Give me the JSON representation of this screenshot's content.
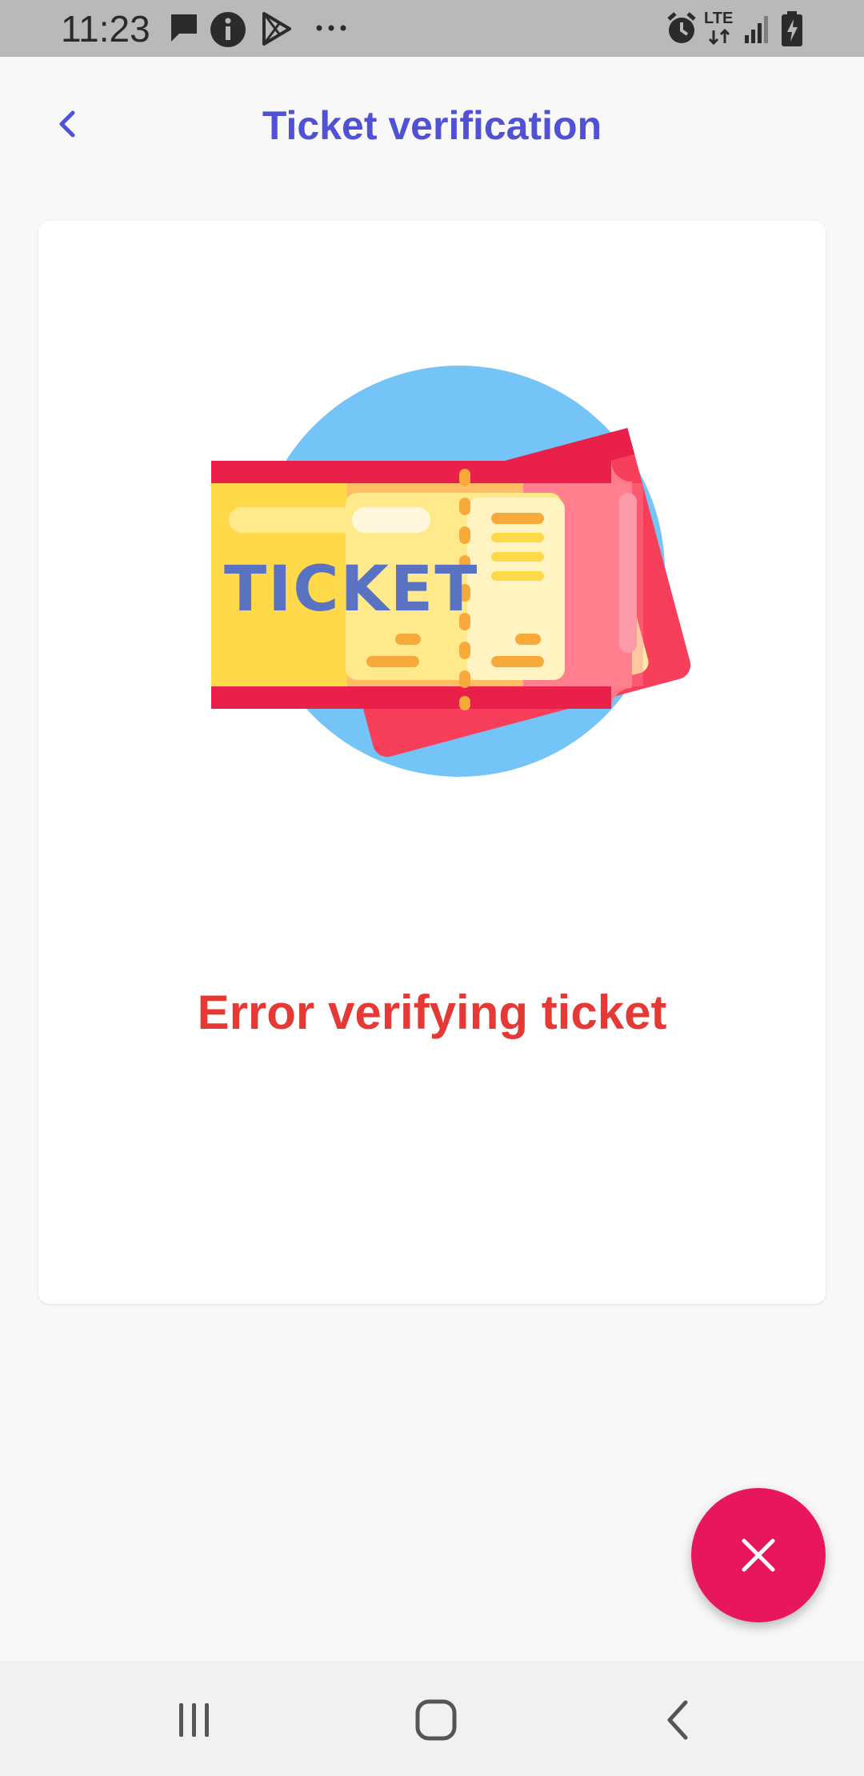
{
  "status_bar": {
    "time": "11:23",
    "left_icons": [
      "message-icon",
      "info-icon",
      "play-store-icon",
      "more-icon"
    ],
    "right_icons": [
      "alarm-icon",
      "lte-icon",
      "signal-icon",
      "battery-icon"
    ],
    "lte_label": "LTE"
  },
  "app_bar": {
    "title": "Ticket verification",
    "back_icon": "chevron-left-icon",
    "accent_color": "#5151d6"
  },
  "card": {
    "illustration": "ticket-illustration",
    "illustration_text": "TICKET",
    "message": "Error verifying ticket",
    "message_color": "#e53935"
  },
  "fab": {
    "icon": "close-icon",
    "color": "#e8175d"
  },
  "nav_bar": {
    "items": [
      "recent-apps-icon",
      "home-icon",
      "back-icon"
    ]
  }
}
